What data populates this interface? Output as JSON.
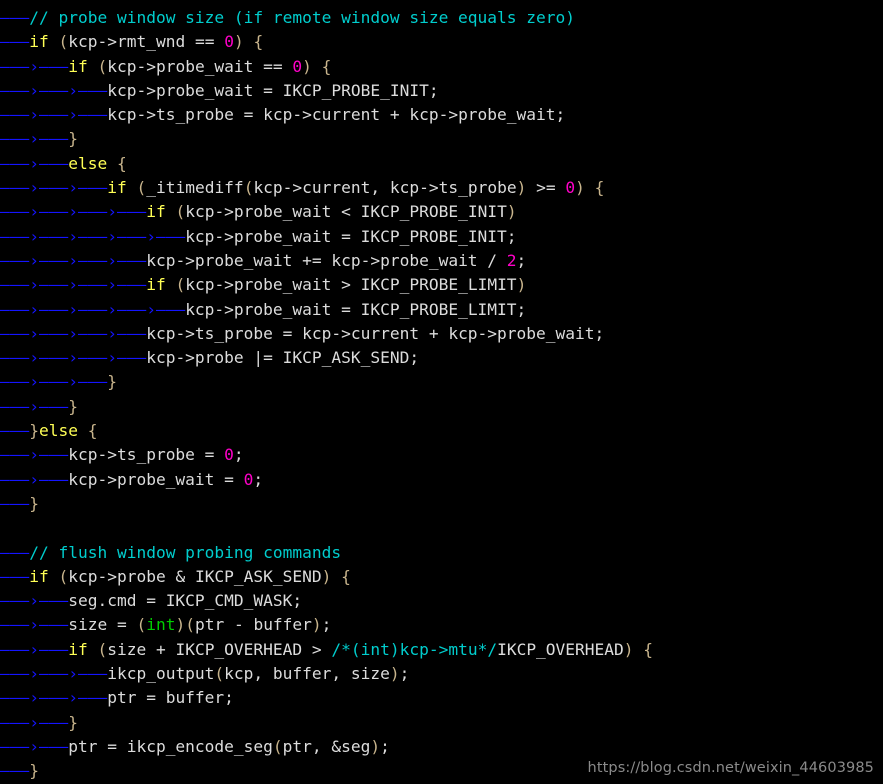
{
  "editor": {
    "background_color": "#000000",
    "default_text_color": "#dcdcdc",
    "tab_marker_color": "#1414ff",
    "tab_marker_first": "———",
    "tab_marker_next": "›———",
    "font_size_px": 16,
    "line_height_px": 24
  },
  "colors": {
    "comment": "#00cdcd",
    "keyword": "#ffff55",
    "type": "#00cd00",
    "number": "#ff00c8",
    "punctuation": "#c8b48c",
    "identifier": "#dcdcdc"
  },
  "watermark": {
    "text": "https://blog.csdn.net/weixin_44603985",
    "color": "#8a8a8a"
  },
  "code": {
    "language": "c",
    "lines": [
      {
        "indent": 1,
        "closer": "",
        "tokens": [
          {
            "t": "// probe window size (if remote window size equals zero)",
            "c": "comment"
          }
        ]
      },
      {
        "indent": 1,
        "closer": "",
        "tokens": [
          {
            "t": "if",
            "c": "keyword"
          },
          {
            "t": " ",
            "c": "plain"
          },
          {
            "t": "(",
            "c": "punc"
          },
          {
            "t": "kcp->rmt_wnd == ",
            "c": "plain"
          },
          {
            "t": "0",
            "c": "number"
          },
          {
            "t": ")",
            "c": "punc"
          },
          {
            "t": " ",
            "c": "plain"
          },
          {
            "t": "{",
            "c": "punc"
          }
        ]
      },
      {
        "indent": 2,
        "closer": "",
        "tokens": [
          {
            "t": "if",
            "c": "keyword"
          },
          {
            "t": " ",
            "c": "plain"
          },
          {
            "t": "(",
            "c": "punc"
          },
          {
            "t": "kcp->probe_wait == ",
            "c": "plain"
          },
          {
            "t": "0",
            "c": "number"
          },
          {
            "t": ")",
            "c": "punc"
          },
          {
            "t": " ",
            "c": "plain"
          },
          {
            "t": "{",
            "c": "punc"
          }
        ]
      },
      {
        "indent": 3,
        "closer": "",
        "tokens": [
          {
            "t": "kcp->probe_wait = IKCP_PROBE_INIT;",
            "c": "plain"
          }
        ]
      },
      {
        "indent": 3,
        "closer": "",
        "tokens": [
          {
            "t": "kcp->ts_probe = kcp->current + kcp->probe_wait;",
            "c": "plain"
          }
        ]
      },
      {
        "indent": 2,
        "closer": "",
        "tokens": [
          {
            "t": "}",
            "c": "punc"
          }
        ]
      },
      {
        "indent": 2,
        "closer": "",
        "tokens": [
          {
            "t": "else",
            "c": "keyword"
          },
          {
            "t": " ",
            "c": "plain"
          },
          {
            "t": "{",
            "c": "punc"
          }
        ]
      },
      {
        "indent": 3,
        "closer": "",
        "tokens": [
          {
            "t": "if",
            "c": "keyword"
          },
          {
            "t": " ",
            "c": "plain"
          },
          {
            "t": "(",
            "c": "punc"
          },
          {
            "t": "_itimediff",
            "c": "plain"
          },
          {
            "t": "(",
            "c": "punc"
          },
          {
            "t": "kcp->current, kcp->ts_probe",
            "c": "plain"
          },
          {
            "t": ")",
            "c": "punc"
          },
          {
            "t": " >= ",
            "c": "plain"
          },
          {
            "t": "0",
            "c": "number"
          },
          {
            "t": ")",
            "c": "punc"
          },
          {
            "t": " ",
            "c": "plain"
          },
          {
            "t": "{",
            "c": "punc"
          }
        ]
      },
      {
        "indent": 4,
        "closer": "",
        "tokens": [
          {
            "t": "if",
            "c": "keyword"
          },
          {
            "t": " ",
            "c": "plain"
          },
          {
            "t": "(",
            "c": "punc"
          },
          {
            "t": "kcp->probe_wait < IKCP_PROBE_INIT",
            "c": "plain"
          },
          {
            "t": ")",
            "c": "punc"
          }
        ]
      },
      {
        "indent": 5,
        "closer": "",
        "tokens": [
          {
            "t": "kcp->probe_wait = IKCP_PROBE_INIT;",
            "c": "plain"
          }
        ]
      },
      {
        "indent": 4,
        "closer": "",
        "tokens": [
          {
            "t": "kcp->probe_wait += kcp->probe_wait / ",
            "c": "plain"
          },
          {
            "t": "2",
            "c": "number"
          },
          {
            "t": ";",
            "c": "plain"
          }
        ]
      },
      {
        "indent": 4,
        "closer": "",
        "tokens": [
          {
            "t": "if",
            "c": "keyword"
          },
          {
            "t": " ",
            "c": "plain"
          },
          {
            "t": "(",
            "c": "punc"
          },
          {
            "t": "kcp->probe_wait > IKCP_PROBE_LIMIT",
            "c": "plain"
          },
          {
            "t": ")",
            "c": "punc"
          }
        ]
      },
      {
        "indent": 5,
        "closer": "",
        "tokens": [
          {
            "t": "kcp->probe_wait = IKCP_PROBE_LIMIT;",
            "c": "plain"
          }
        ]
      },
      {
        "indent": 4,
        "closer": "",
        "tokens": [
          {
            "t": "kcp->ts_probe = kcp->current + kcp->probe_wait;",
            "c": "plain"
          }
        ]
      },
      {
        "indent": 4,
        "closer": "",
        "tokens": [
          {
            "t": "kcp->probe |= IKCP_ASK_SEND;",
            "c": "plain"
          }
        ]
      },
      {
        "indent": 3,
        "closer": "",
        "tokens": [
          {
            "t": "}",
            "c": "punc"
          }
        ]
      },
      {
        "indent": 2,
        "closer": "",
        "tokens": [
          {
            "t": "}",
            "c": "punc"
          }
        ]
      },
      {
        "indent": 1,
        "closer": "}",
        "tokens": [
          {
            "t": "else",
            "c": "keyword"
          },
          {
            "t": " ",
            "c": "plain"
          },
          {
            "t": "{",
            "c": "punc"
          }
        ]
      },
      {
        "indent": 2,
        "closer": "",
        "tokens": [
          {
            "t": "kcp->ts_probe = ",
            "c": "plain"
          },
          {
            "t": "0",
            "c": "number"
          },
          {
            "t": ";",
            "c": "plain"
          }
        ]
      },
      {
        "indent": 2,
        "closer": "",
        "tokens": [
          {
            "t": "kcp->probe_wait = ",
            "c": "plain"
          },
          {
            "t": "0",
            "c": "number"
          },
          {
            "t": ";",
            "c": "plain"
          }
        ]
      },
      {
        "indent": 1,
        "closer": "",
        "tokens": [
          {
            "t": "}",
            "c": "punc"
          }
        ]
      },
      {
        "indent": 0,
        "closer": "",
        "tokens": []
      },
      {
        "indent": 1,
        "closer": "",
        "tokens": [
          {
            "t": "// flush window probing commands",
            "c": "comment"
          }
        ]
      },
      {
        "indent": 1,
        "closer": "",
        "tokens": [
          {
            "t": "if",
            "c": "keyword"
          },
          {
            "t": " ",
            "c": "plain"
          },
          {
            "t": "(",
            "c": "punc"
          },
          {
            "t": "kcp->probe & IKCP_ASK_SEND",
            "c": "plain"
          },
          {
            "t": ")",
            "c": "punc"
          },
          {
            "t": " ",
            "c": "plain"
          },
          {
            "t": "{",
            "c": "punc"
          }
        ]
      },
      {
        "indent": 2,
        "closer": "",
        "tokens": [
          {
            "t": "seg.cmd = IKCP_CMD_WASK;",
            "c": "plain"
          }
        ]
      },
      {
        "indent": 2,
        "closer": "",
        "tokens": [
          {
            "t": "size = ",
            "c": "plain"
          },
          {
            "t": "(",
            "c": "punc"
          },
          {
            "t": "int",
            "c": "type"
          },
          {
            "t": ")",
            "c": "punc"
          },
          {
            "t": "(",
            "c": "punc"
          },
          {
            "t": "ptr - buffer",
            "c": "plain"
          },
          {
            "t": ")",
            "c": "punc"
          },
          {
            "t": ";",
            "c": "plain"
          }
        ]
      },
      {
        "indent": 2,
        "closer": "",
        "tokens": [
          {
            "t": "if",
            "c": "keyword"
          },
          {
            "t": " ",
            "c": "plain"
          },
          {
            "t": "(",
            "c": "punc"
          },
          {
            "t": "size + IKCP_OVERHEAD > ",
            "c": "plain"
          },
          {
            "t": "/*(int)kcp->mtu*/",
            "c": "comment"
          },
          {
            "t": "IKCP_OVERHEAD",
            "c": "plain"
          },
          {
            "t": ")",
            "c": "punc"
          },
          {
            "t": " ",
            "c": "plain"
          },
          {
            "t": "{",
            "c": "punc"
          }
        ]
      },
      {
        "indent": 3,
        "closer": "",
        "tokens": [
          {
            "t": "ikcp_output",
            "c": "plain"
          },
          {
            "t": "(",
            "c": "punc"
          },
          {
            "t": "kcp, buffer, size",
            "c": "plain"
          },
          {
            "t": ")",
            "c": "punc"
          },
          {
            "t": ";",
            "c": "plain"
          }
        ]
      },
      {
        "indent": 3,
        "closer": "",
        "tokens": [
          {
            "t": "ptr = buffer;",
            "c": "plain"
          }
        ]
      },
      {
        "indent": 2,
        "closer": "",
        "tokens": [
          {
            "t": "}",
            "c": "punc"
          }
        ]
      },
      {
        "indent": 2,
        "closer": "",
        "tokens": [
          {
            "t": "ptr = ikcp_encode_seg",
            "c": "plain"
          },
          {
            "t": "(",
            "c": "punc"
          },
          {
            "t": "ptr, &seg",
            "c": "plain"
          },
          {
            "t": ")",
            "c": "punc"
          },
          {
            "t": ";",
            "c": "plain"
          }
        ]
      },
      {
        "indent": 1,
        "closer": "",
        "tokens": [
          {
            "t": "}",
            "c": "punc"
          }
        ]
      }
    ]
  }
}
